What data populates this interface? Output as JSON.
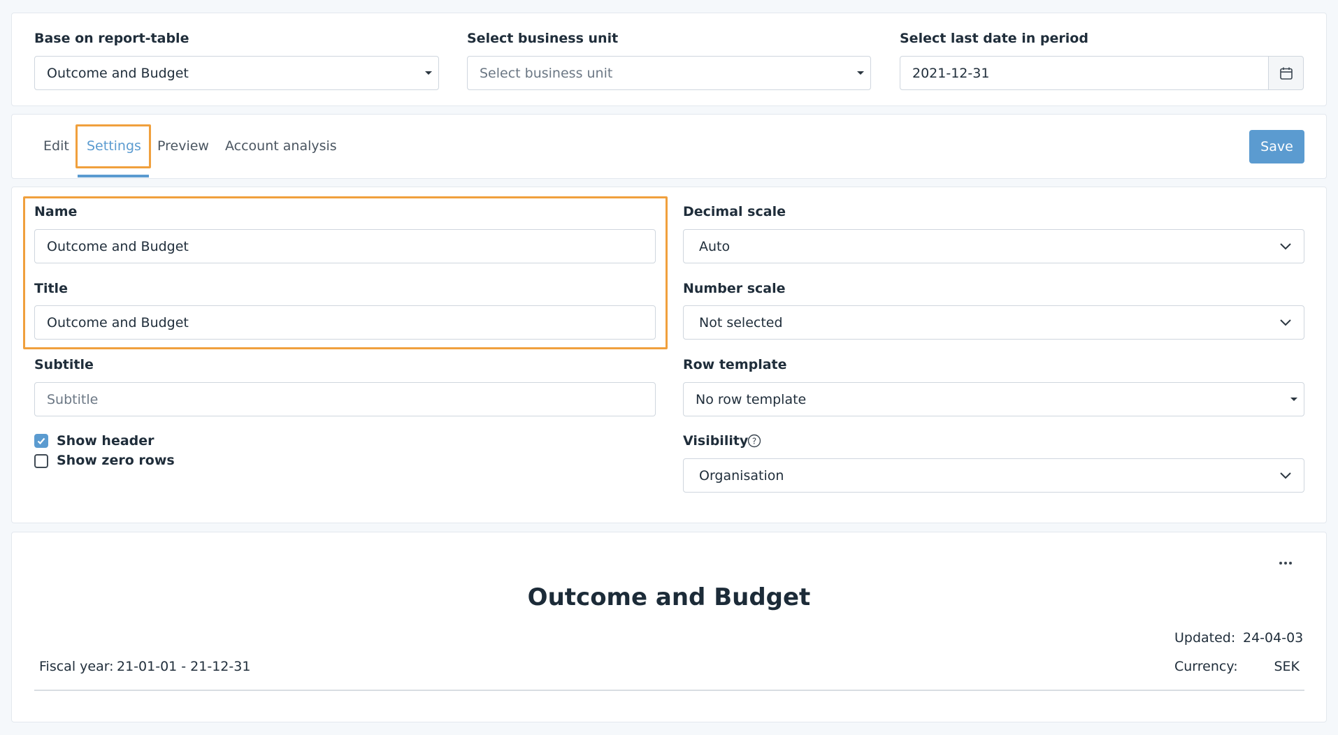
{
  "top_filters": {
    "report_table": {
      "label": "Base on report-table",
      "value": "Outcome and Budget"
    },
    "business_unit": {
      "label": "Select business unit",
      "placeholder": "Select business unit"
    },
    "last_date": {
      "label": "Select last date in period",
      "value": "2021-12-31"
    }
  },
  "tabs": [
    {
      "label": "Edit"
    },
    {
      "label": "Settings"
    },
    {
      "label": "Preview"
    },
    {
      "label": "Account analysis"
    }
  ],
  "save_label": "Save",
  "settings": {
    "name": {
      "label": "Name",
      "value": "Outcome and Budget"
    },
    "title": {
      "label": "Title",
      "value": "Outcome and Budget"
    },
    "subtitle": {
      "label": "Subtitle",
      "placeholder": "Subtitle"
    },
    "show_header": {
      "label": "Show header",
      "checked": true
    },
    "show_zero_rows": {
      "label": "Show zero rows",
      "checked": false
    },
    "decimal_scale": {
      "label": "Decimal scale",
      "value": "Auto"
    },
    "number_scale": {
      "label": "Number scale",
      "value": "Not selected"
    },
    "row_template": {
      "label": "Row template",
      "value": "No row template"
    },
    "visibility": {
      "label": "Visibility",
      "value": "Organisation"
    }
  },
  "preview": {
    "menu_icon": "ellipsis-icon",
    "report_title": "Outcome and Budget",
    "updated_label": "Updated:",
    "updated_value": "24-04-03",
    "fiscal_label": "Fiscal year:",
    "fiscal_value": "21-01-01 - 21-12-31",
    "currency_label": "Currency:",
    "currency_value": "SEK"
  },
  "colors": {
    "accent": "#5b9bd0",
    "highlight": "#f0a03d"
  }
}
